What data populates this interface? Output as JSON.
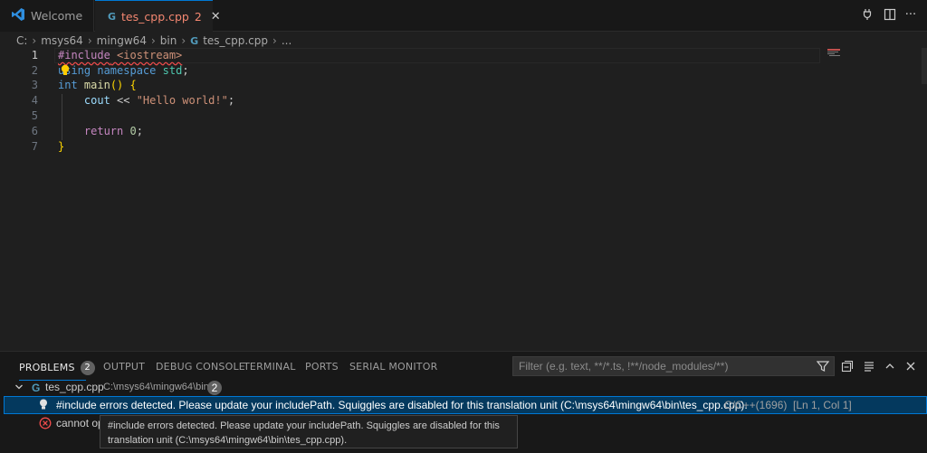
{
  "tabs": [
    {
      "label": "Welcome",
      "icon": "vscode-logo-icon"
    },
    {
      "label": "tes_cpp.cpp",
      "problems": "2",
      "icon": "cpp-file-icon"
    }
  ],
  "breadcrumb": {
    "items": [
      "C:",
      "msys64",
      "mingw64",
      "bin",
      "tes_cpp.cpp",
      "..."
    ]
  },
  "editor": {
    "line_numbers": [
      "1",
      "2",
      "3",
      "4",
      "5",
      "6",
      "7"
    ],
    "lines": [
      {
        "t1": "#include",
        "t2": " ",
        "t3": "<iostream>"
      },
      {
        "t1": "using",
        "t2": " ",
        "t3": "namespace",
        "t4": " ",
        "t5": "std",
        "t6": ";"
      },
      {
        "t1": "int",
        "t2": " ",
        "t3": "main",
        "t4": "()",
        "t5": " ",
        "t6": "{"
      },
      {
        "t1": "    cout",
        "t2": " << ",
        "t3": "\"Hello world!\"",
        "t4": ";"
      },
      {},
      {
        "t1": "    ",
        "t2": "return",
        "t3": " ",
        "t4": "0",
        "t5": ";"
      },
      {
        "t1": "}"
      }
    ]
  },
  "panel": {
    "tabs": {
      "problems": "PROBLEMS",
      "problems_count": "2",
      "output": "OUTPUT",
      "debug_console": "DEBUG CONSOLE",
      "terminal": "TERMINAL",
      "ports": "PORTS",
      "serial_monitor": "SERIAL MONITOR"
    },
    "filter_placeholder": "Filter (e.g. text, **/*.ts, !**/node_modules/**)",
    "file": {
      "name": "tes_cpp.cpp",
      "path": "C:\\msys64\\mingw64\\bin",
      "count": "2"
    },
    "problems": [
      {
        "icon": "lightbulb-icon",
        "message": "#include errors detected. Please update your includePath. Squiggles are disabled for this translation unit (C:\\msys64\\mingw64\\bin\\tes_cpp.cpp).",
        "source": "C/C++(1696)",
        "location": "[Ln 1, Col 1]"
      },
      {
        "icon": "error-icon",
        "message": "cannot op"
      }
    ],
    "tooltip": {
      "line1": "#include errors detected. Please update your includePath. Squiggles are disabled for this",
      "line2": "translation unit (C:\\msys64\\mingw64\\bin\\tes_cpp.cpp)."
    }
  },
  "colors": {
    "accent": "#0078d4",
    "error": "#f14c4c",
    "tab_error": "#f48771",
    "selection": "#04395e"
  }
}
